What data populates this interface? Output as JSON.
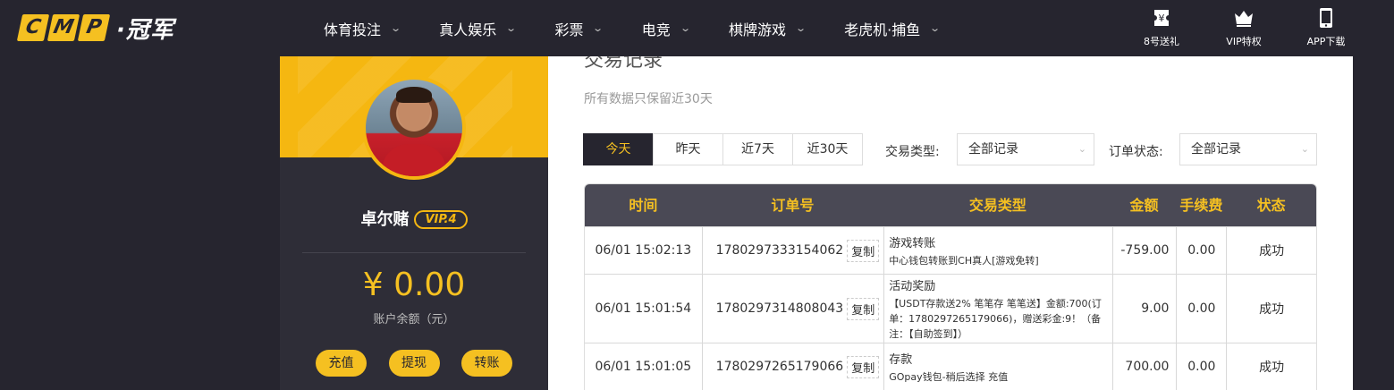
{
  "brand": {
    "logo_letters": [
      "C",
      "M",
      "P"
    ],
    "logo_text": "·冠军"
  },
  "nav": [
    {
      "label": "体育投注"
    },
    {
      "label": "真人娱乐"
    },
    {
      "label": "彩票"
    },
    {
      "label": "电竞"
    },
    {
      "label": "棋牌游戏"
    },
    {
      "label": "老虎机·捕鱼"
    }
  ],
  "header_right": {
    "gift_label": "8号送礼",
    "vip_label": "VIP特权",
    "app_label": "APP下载"
  },
  "profile": {
    "username": "卓尔赌",
    "vip_badge": "VIP.4",
    "balance": "¥ 0.00",
    "balance_label": "账户余额（元）",
    "actions": {
      "deposit": "充值",
      "withdraw": "提现",
      "transfer": "转账"
    }
  },
  "main": {
    "title": "交易记录",
    "notice": "所有数据只保留近30天",
    "date_tabs": [
      "今天",
      "昨天",
      "近7天",
      "近30天"
    ],
    "active_tab": "今天",
    "type_filter": {
      "label": "交易类型:",
      "value": "全部记录"
    },
    "status_filter": {
      "label": "订单状态:",
      "value": "全部记录"
    },
    "columns": [
      "时间",
      "订单号",
      "交易类型",
      "金额",
      "手续费",
      "状态"
    ],
    "copy_label": "复制",
    "rows": [
      {
        "time": "06/01 15:02:13",
        "order_no": "1780297333154062",
        "type_title": "游戏转账",
        "type_detail": "中心钱包转账到CH真人[游戏免转]",
        "amount": "-759.00",
        "fee": "0.00",
        "status": "成功"
      },
      {
        "time": "06/01 15:01:54",
        "order_no": "1780297314808043",
        "type_title": "活动奖励",
        "type_detail": "【USDT存款送2% 笔笔存 笔笔送】金额:700(订单：1780297265179066)，赠送彩金:9！（备注：【自助签到】）",
        "amount": "9.00",
        "fee": "0.00",
        "status": "成功"
      },
      {
        "time": "06/01 15:01:05",
        "order_no": "1780297265179066",
        "type_title": "存款",
        "type_detail": "GOpay钱包-稍后选择 充值",
        "amount": "700.00",
        "fee": "0.00",
        "status": "成功"
      }
    ]
  },
  "colors": {
    "accent": "#f5c021",
    "dark": "#26252f",
    "success": "#2a9d2a"
  }
}
